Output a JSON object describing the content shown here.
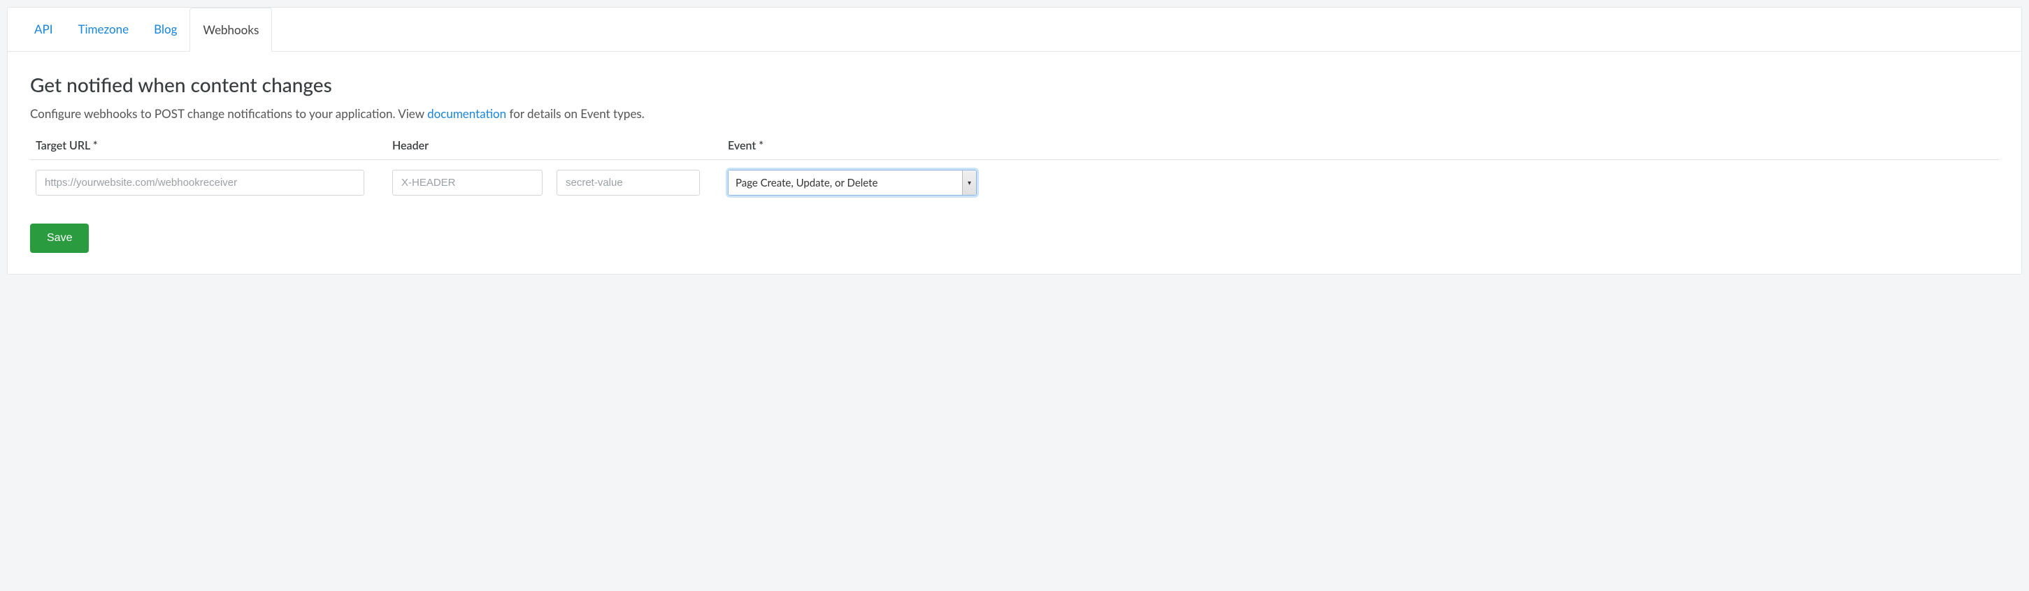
{
  "tabs": {
    "api": "API",
    "timezone": "Timezone",
    "blog": "Blog",
    "webhooks": "Webhooks"
  },
  "page": {
    "title": "Get notified when content changes",
    "desc_pre": "Configure webhooks to POST change notifications to your application. View ",
    "desc_link": "documentation",
    "desc_post": " for details on Event types."
  },
  "columns": {
    "target": "Target URL *",
    "header": "Header",
    "event": "Event *"
  },
  "form": {
    "target_placeholder": "https://yourwebsite.com/webhookreceiver",
    "header_key_placeholder": "X-HEADER",
    "header_val_placeholder": "secret-value",
    "event_value": "Page Create, Update, or Delete"
  },
  "buttons": {
    "save": "Save"
  }
}
